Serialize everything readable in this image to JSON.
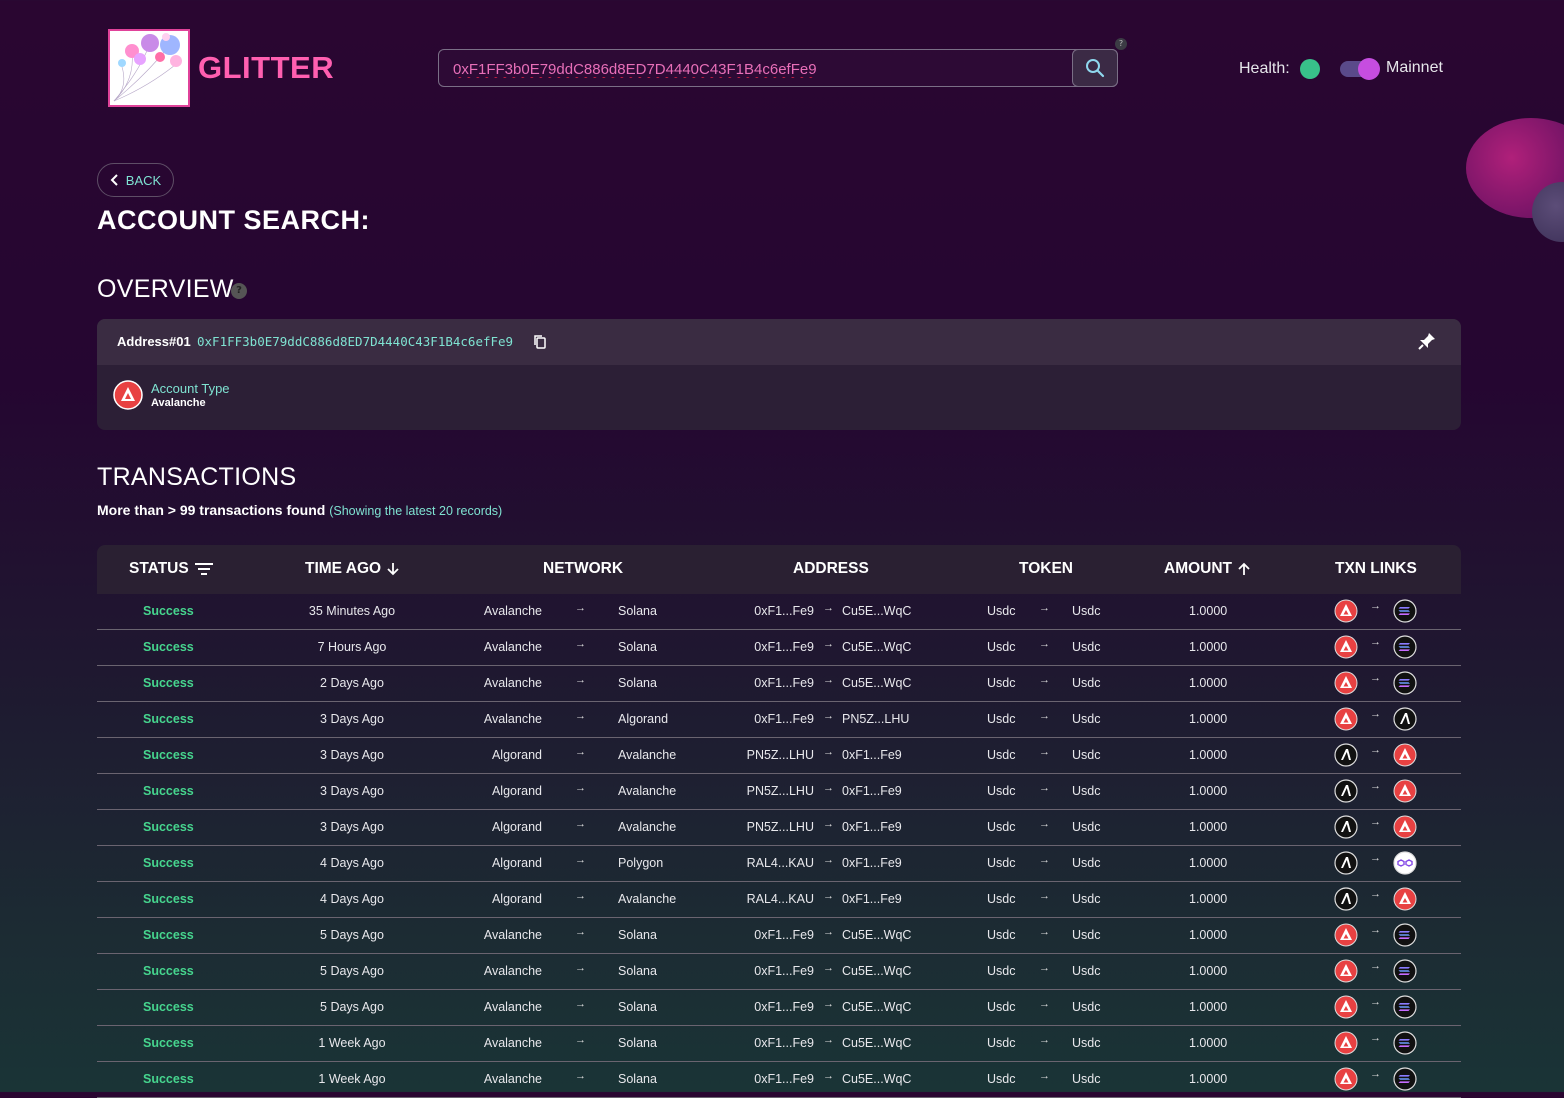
{
  "header": {
    "brand": "GLITTER",
    "search_value": "0xF1FF3b0E79ddC886d8ED7D4440C43F1B4c6efFe9",
    "help_mark": "?",
    "health_label": "Health:",
    "health_status_color": "#38c18a",
    "network_label": "Mainnet"
  },
  "nav": {
    "back_label": "BACK"
  },
  "page": {
    "title": "ACCOUNT SEARCH:"
  },
  "overview": {
    "title": "OVERVIEW",
    "help_mark": "?",
    "address_label": "Address#01",
    "address_value": "0xF1FF3b0E79ddC886d8ED7D4440C43F1B4c6efFe9",
    "account_type_label": "Account Type",
    "account_type_value": "Avalanche"
  },
  "transactions": {
    "title": "TRANSACTIONS",
    "count_text": "More than > 99 transactions found",
    "showing_text": "(Showing the latest 20 records)",
    "columns": [
      "STATUS",
      "TIME AGO",
      "NETWORK",
      "ADDRESS",
      "TOKEN",
      "AMOUNT",
      "TXN LINKS"
    ],
    "rows": [
      {
        "status": "Success",
        "time": "35 Minutes Ago",
        "from_net": "Avalanche",
        "to_net": "Solana",
        "from_addr": "0xF1...Fe9",
        "to_addr": "Cu5E...WqC",
        "from_token": "Usdc",
        "to_token": "Usdc",
        "amount": "1.0000",
        "from_icon": "avalanche",
        "to_icon": "solana"
      },
      {
        "status": "Success",
        "time": "7 Hours Ago",
        "from_net": "Avalanche",
        "to_net": "Solana",
        "from_addr": "0xF1...Fe9",
        "to_addr": "Cu5E...WqC",
        "from_token": "Usdc",
        "to_token": "Usdc",
        "amount": "1.0000",
        "from_icon": "avalanche",
        "to_icon": "solana"
      },
      {
        "status": "Success",
        "time": "2 Days Ago",
        "from_net": "Avalanche",
        "to_net": "Solana",
        "from_addr": "0xF1...Fe9",
        "to_addr": "Cu5E...WqC",
        "from_token": "Usdc",
        "to_token": "Usdc",
        "amount": "1.0000",
        "from_icon": "avalanche",
        "to_icon": "solana"
      },
      {
        "status": "Success",
        "time": "3 Days Ago",
        "from_net": "Avalanche",
        "to_net": "Algorand",
        "from_addr": "0xF1...Fe9",
        "to_addr": "PN5Z...LHU",
        "from_token": "Usdc",
        "to_token": "Usdc",
        "amount": "1.0000",
        "from_icon": "avalanche",
        "to_icon": "algorand"
      },
      {
        "status": "Success",
        "time": "3 Days Ago",
        "from_net": "Algorand",
        "to_net": "Avalanche",
        "from_addr": "PN5Z...LHU",
        "to_addr": "0xF1...Fe9",
        "from_token": "Usdc",
        "to_token": "Usdc",
        "amount": "1.0000",
        "from_icon": "algorand",
        "to_icon": "avalanche"
      },
      {
        "status": "Success",
        "time": "3 Days Ago",
        "from_net": "Algorand",
        "to_net": "Avalanche",
        "from_addr": "PN5Z...LHU",
        "to_addr": "0xF1...Fe9",
        "from_token": "Usdc",
        "to_token": "Usdc",
        "amount": "1.0000",
        "from_icon": "algorand",
        "to_icon": "avalanche"
      },
      {
        "status": "Success",
        "time": "3 Days Ago",
        "from_net": "Algorand",
        "to_net": "Avalanche",
        "from_addr": "PN5Z...LHU",
        "to_addr": "0xF1...Fe9",
        "from_token": "Usdc",
        "to_token": "Usdc",
        "amount": "1.0000",
        "from_icon": "algorand",
        "to_icon": "avalanche"
      },
      {
        "status": "Success",
        "time": "4 Days Ago",
        "from_net": "Algorand",
        "to_net": "Polygon",
        "from_addr": "RAL4...KAU",
        "to_addr": "0xF1...Fe9",
        "from_token": "Usdc",
        "to_token": "Usdc",
        "amount": "1.0000",
        "from_icon": "algorand",
        "to_icon": "polygon"
      },
      {
        "status": "Success",
        "time": "4 Days Ago",
        "from_net": "Algorand",
        "to_net": "Avalanche",
        "from_addr": "RAL4...KAU",
        "to_addr": "0xF1...Fe9",
        "from_token": "Usdc",
        "to_token": "Usdc",
        "amount": "1.0000",
        "from_icon": "algorand",
        "to_icon": "avalanche"
      },
      {
        "status": "Success",
        "time": "5 Days Ago",
        "from_net": "Avalanche",
        "to_net": "Solana",
        "from_addr": "0xF1...Fe9",
        "to_addr": "Cu5E...WqC",
        "from_token": "Usdc",
        "to_token": "Usdc",
        "amount": "1.0000",
        "from_icon": "avalanche",
        "to_icon": "solana"
      },
      {
        "status": "Success",
        "time": "5 Days Ago",
        "from_net": "Avalanche",
        "to_net": "Solana",
        "from_addr": "0xF1...Fe9",
        "to_addr": "Cu5E...WqC",
        "from_token": "Usdc",
        "to_token": "Usdc",
        "amount": "1.0000",
        "from_icon": "avalanche",
        "to_icon": "solana"
      },
      {
        "status": "Success",
        "time": "5 Days Ago",
        "from_net": "Avalanche",
        "to_net": "Solana",
        "from_addr": "0xF1...Fe9",
        "to_addr": "Cu5E...WqC",
        "from_token": "Usdc",
        "to_token": "Usdc",
        "amount": "1.0000",
        "from_icon": "avalanche",
        "to_icon": "solana"
      },
      {
        "status": "Success",
        "time": "1 Week Ago",
        "from_net": "Avalanche",
        "to_net": "Solana",
        "from_addr": "0xF1...Fe9",
        "to_addr": "Cu5E...WqC",
        "from_token": "Usdc",
        "to_token": "Usdc",
        "amount": "1.0000",
        "from_icon": "avalanche",
        "to_icon": "solana"
      },
      {
        "status": "Success",
        "time": "1 Week Ago",
        "from_net": "Avalanche",
        "to_net": "Solana",
        "from_addr": "0xF1...Fe9",
        "to_addr": "Cu5E...WqC",
        "from_token": "Usdc",
        "to_token": "Usdc",
        "amount": "1.0000",
        "from_icon": "avalanche",
        "to_icon": "solana"
      }
    ]
  },
  "colors": {
    "accent_teal": "#7fe3d2",
    "brand_pink": "#ff5fb0",
    "success_green": "#46d58e",
    "avalanche_red": "#e84142"
  }
}
